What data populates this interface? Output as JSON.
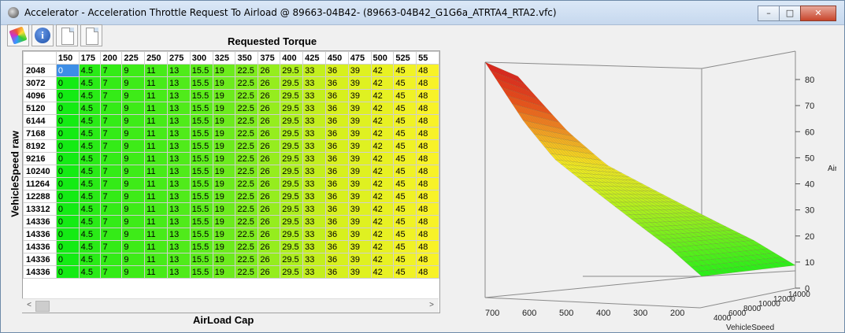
{
  "window": {
    "title": "Accelerator - Acceleration Throttle Request To Airload @ 89663-04B42- (89663-04B42_G1G6a_ATRTA4_RTA2.vfc)",
    "minimize": "–",
    "maximize": "□",
    "close": "✕"
  },
  "toolbar": {
    "items": [
      {
        "name": "color-palette-button",
        "icon": "palette-icon"
      },
      {
        "name": "info-button",
        "icon": "info-icon",
        "glyph": "i"
      },
      {
        "name": "copy-button",
        "icon": "document-icon"
      },
      {
        "name": "paste-button",
        "icon": "document-icon"
      }
    ]
  },
  "table": {
    "column_axis_title": "Requested Torque",
    "row_axis_title": "VehicleSpeed raw",
    "bottom_title": "AirLoad Cap",
    "columns": [
      "150",
      "175",
      "200",
      "225",
      "250",
      "275",
      "300",
      "325",
      "350",
      "375",
      "400",
      "425",
      "450",
      "475",
      "500",
      "525",
      "55"
    ],
    "rows": [
      "2048",
      "3072",
      "4096",
      "5120",
      "6144",
      "7168",
      "8192",
      "9216",
      "10240",
      "11264",
      "12288",
      "13312",
      "14336",
      "14336",
      "14336",
      "14336",
      "14336"
    ],
    "row_values": [
      "0",
      "4.5",
      "7",
      "9",
      "11",
      "13",
      "15.5",
      "19",
      "22.5",
      "26",
      "29.5",
      "33",
      "36",
      "39",
      "42",
      "45",
      "48"
    ],
    "selected_cell": [
      0,
      0
    ]
  },
  "scrollbar": {
    "left_arrow": "<",
    "right_arrow": ">"
  },
  "plot3d": {
    "z_ticks": [
      "0",
      "10",
      "20",
      "30",
      "40",
      "50",
      "60",
      "70",
      "80"
    ],
    "z_label": "Air",
    "x_ticks": [
      "700",
      "600",
      "500",
      "400",
      "300",
      "200"
    ],
    "y_ticks": [
      "4000",
      "6000",
      "8000",
      "10000",
      "12000",
      "14000"
    ],
    "y_label": "VehicleSpeed",
    "colors": {
      "low": "#33ee1a",
      "mid": "#f6f01e",
      "high": "#e61414"
    }
  }
}
